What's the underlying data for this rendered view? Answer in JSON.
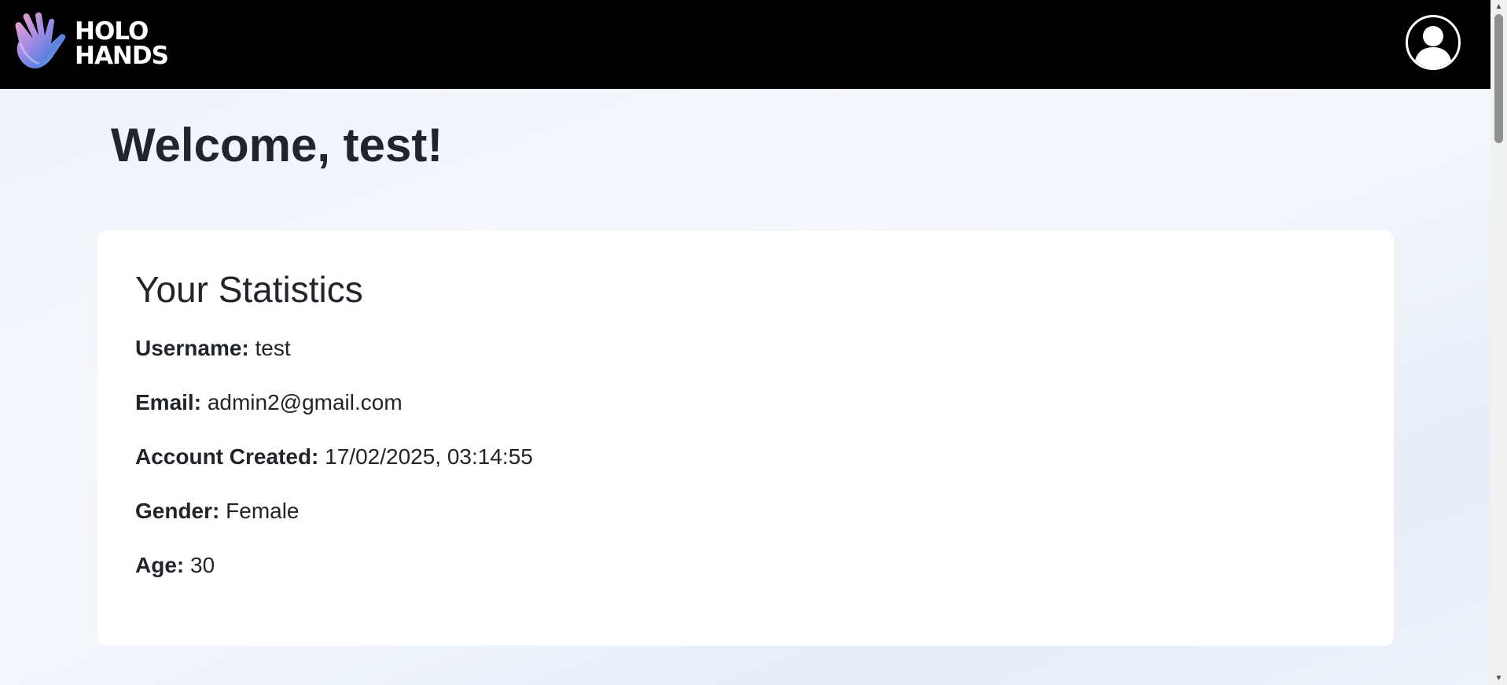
{
  "brand": {
    "line1": "HOLO",
    "line2": "HANDS",
    "icon": "hand-icon"
  },
  "header": {
    "avatar_icon": "user-avatar-icon"
  },
  "welcome": {
    "title": "Welcome, test!"
  },
  "stats": {
    "heading": "Your Statistics",
    "items": [
      {
        "label": "Username:",
        "value": "test"
      },
      {
        "label": "Email:",
        "value": "admin2@gmail.com"
      },
      {
        "label": "Account Created:",
        "value": "17/02/2025, 03:14:55"
      },
      {
        "label": "Gender:",
        "value": "Female"
      },
      {
        "label": "Age:",
        "value": "30"
      }
    ]
  },
  "colors": {
    "topbar": "#000000",
    "card": "#ffffff",
    "text": "#212529",
    "hand_gradient": [
      "#f2a9c6",
      "#8e7fe0",
      "#5b86e0",
      "#86c7f2"
    ]
  }
}
